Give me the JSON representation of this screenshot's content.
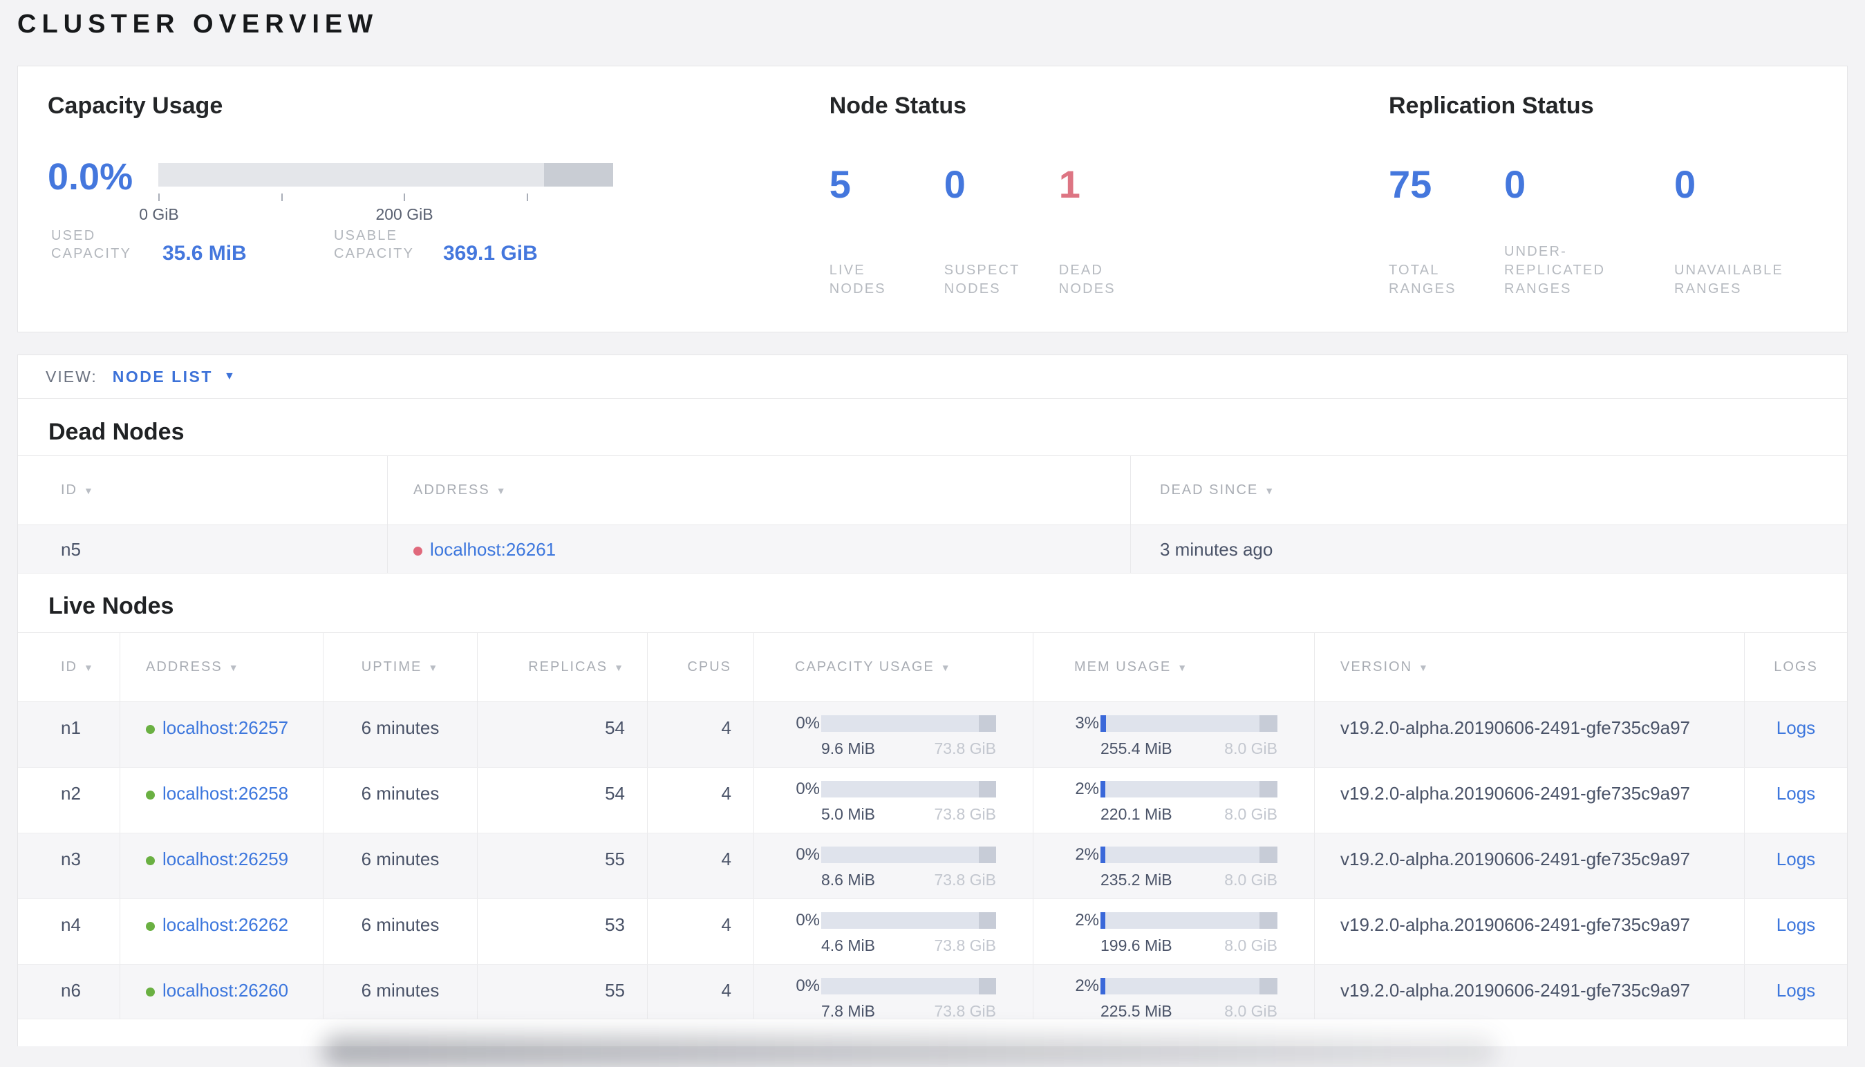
{
  "page_title": "CLUSTER OVERVIEW",
  "colors": {
    "accent_blue": "#4477dd",
    "link_blue": "#3d77dd",
    "danger_red": "#dd7583",
    "dead_dot_red": "#e0697c",
    "live_dot_green": "#6ab042",
    "bar_track": "#dfe3ec",
    "bar_reserved": "#c7ccd7",
    "bar_fill_blue": "#3a68d9"
  },
  "summary": {
    "capacity": {
      "title": "Capacity Usage",
      "percent": "0.0%",
      "axis_ticks": [
        {
          "label": "0 GiB",
          "pos": 0
        },
        {
          "label": "",
          "pos": 178
        },
        {
          "label": "200 GiB",
          "pos": 355
        },
        {
          "label": "",
          "pos": 533
        }
      ],
      "stats": [
        {
          "label": "USED CAPACITY",
          "value": "35.6 MiB"
        },
        {
          "label": "USABLE CAPACITY",
          "value": "369.1 GiB"
        }
      ]
    },
    "node_status": {
      "title": "Node Status",
      "stats": [
        {
          "value": "5",
          "label": "LIVE NODES"
        },
        {
          "value": "0",
          "label": "SUSPECT NODES"
        },
        {
          "value": "1",
          "label": "DEAD NODES"
        }
      ]
    },
    "replication_status": {
      "title": "Replication Status",
      "stats": [
        {
          "value": "75",
          "label": "TOTAL RANGES"
        },
        {
          "value": "0",
          "label": "UNDER-REPLICATED RANGES"
        },
        {
          "value": "0",
          "label": "UNAVAILABLE RANGES"
        }
      ]
    }
  },
  "view_bar": {
    "label": "VIEW:",
    "selected": "NODE LIST"
  },
  "dead_nodes": {
    "title": "Dead Nodes",
    "columns": [
      {
        "label": "ID",
        "sortable": true
      },
      {
        "label": "ADDRESS",
        "sortable": true
      },
      {
        "label": "DEAD SINCE",
        "sortable": true
      }
    ],
    "rows": [
      {
        "id": "n5",
        "address": "localhost:26261",
        "dead_since": "3 minutes ago"
      }
    ]
  },
  "live_nodes": {
    "title": "Live Nodes",
    "columns": [
      {
        "label": "ID",
        "sortable": true
      },
      {
        "label": "ADDRESS",
        "sortable": true
      },
      {
        "label": "UPTIME",
        "sortable": true
      },
      {
        "label": "REPLICAS",
        "sortable": true
      },
      {
        "label": "CPUS",
        "sortable": false
      },
      {
        "label": "CAPACITY USAGE",
        "sortable": true
      },
      {
        "label": "MEM USAGE",
        "sortable": true
      },
      {
        "label": "VERSION",
        "sortable": true
      },
      {
        "label": "LOGS",
        "sortable": false
      }
    ],
    "rows": [
      {
        "id": "n1",
        "address": "localhost:26257",
        "uptime": "6 minutes",
        "replicas": "54",
        "cpus": "4",
        "capacity": {
          "percent": "0%",
          "percent_value": 0,
          "used": "9.6 MiB",
          "total": "73.8 GiB"
        },
        "memory": {
          "percent": "3%",
          "percent_value": 3,
          "used": "255.4 MiB",
          "total": "8.0 GiB"
        },
        "version": "v19.2.0-alpha.20190606-2491-gfe735c9a97",
        "logs_label": "Logs"
      },
      {
        "id": "n2",
        "address": "localhost:26258",
        "uptime": "6 minutes",
        "replicas": "54",
        "cpus": "4",
        "capacity": {
          "percent": "0%",
          "percent_value": 0,
          "used": "5.0 MiB",
          "total": "73.8 GiB"
        },
        "memory": {
          "percent": "2%",
          "percent_value": 2,
          "used": "220.1 MiB",
          "total": "8.0 GiB"
        },
        "version": "v19.2.0-alpha.20190606-2491-gfe735c9a97",
        "logs_label": "Logs"
      },
      {
        "id": "n3",
        "address": "localhost:26259",
        "uptime": "6 minutes",
        "replicas": "55",
        "cpus": "4",
        "capacity": {
          "percent": "0%",
          "percent_value": 0,
          "used": "8.6 MiB",
          "total": "73.8 GiB"
        },
        "memory": {
          "percent": "2%",
          "percent_value": 2,
          "used": "235.2 MiB",
          "total": "8.0 GiB"
        },
        "version": "v19.2.0-alpha.20190606-2491-gfe735c9a97",
        "logs_label": "Logs"
      },
      {
        "id": "n4",
        "address": "localhost:26262",
        "uptime": "6 minutes",
        "replicas": "53",
        "cpus": "4",
        "capacity": {
          "percent": "0%",
          "percent_value": 0,
          "used": "4.6 MiB",
          "total": "73.8 GiB"
        },
        "memory": {
          "percent": "2%",
          "percent_value": 2,
          "used": "199.6 MiB",
          "total": "8.0 GiB"
        },
        "version": "v19.2.0-alpha.20190606-2491-gfe735c9a97",
        "logs_label": "Logs"
      },
      {
        "id": "n6",
        "address": "localhost:26260",
        "uptime": "6 minutes",
        "replicas": "55",
        "cpus": "4",
        "capacity": {
          "percent": "0%",
          "percent_value": 0,
          "used": "7.8 MiB",
          "total": "73.8 GiB"
        },
        "memory": {
          "percent": "2%",
          "percent_value": 2,
          "used": "225.5 MiB",
          "total": "8.0 GiB"
        },
        "version": "v19.2.0-alpha.20190606-2491-gfe735c9a97",
        "logs_label": "Logs"
      }
    ]
  }
}
